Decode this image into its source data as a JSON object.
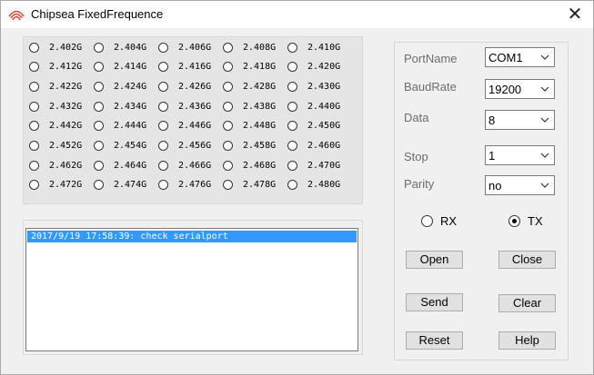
{
  "window": {
    "title": "Chipsea FixedFrequence",
    "close_glyph": "✕"
  },
  "frequencies": [
    "2.402G",
    "2.404G",
    "2.406G",
    "2.408G",
    "2.410G",
    "2.412G",
    "2.414G",
    "2.416G",
    "2.418G",
    "2.420G",
    "2.422G",
    "2.424G",
    "2.426G",
    "2.428G",
    "2.430G",
    "2.432G",
    "2.434G",
    "2.436G",
    "2.438G",
    "2.440G",
    "2.442G",
    "2.444G",
    "2.446G",
    "2.448G",
    "2.450G",
    "2.452G",
    "2.454G",
    "2.456G",
    "2.458G",
    "2.460G",
    "2.462G",
    "2.464G",
    "2.466G",
    "2.468G",
    "2.470G",
    "2.472G",
    "2.474G",
    "2.476G",
    "2.478G",
    "2.480G"
  ],
  "log": {
    "lines": [
      "2017/9/19 17:58:39: check serialport"
    ]
  },
  "settings": {
    "port": {
      "label": "PortName",
      "value": "COM1"
    },
    "baud": {
      "label": "BaudRate",
      "value": "19200"
    },
    "data": {
      "label": "Data",
      "value": "8"
    },
    "stop": {
      "label": "Stop",
      "value": "1"
    },
    "parity": {
      "label": "Parity",
      "value": "no"
    }
  },
  "mode": {
    "rx_label": "RX",
    "tx_label": "TX",
    "selected": "TX"
  },
  "buttons": {
    "open": "Open",
    "close": "Close",
    "send": "Send",
    "clear": "Clear",
    "reset": "Reset",
    "help": "Help"
  },
  "colors": {
    "selection": "#3399ff",
    "panel_bg": "#e5e5e5",
    "window_bg": "#f0f0f0"
  }
}
